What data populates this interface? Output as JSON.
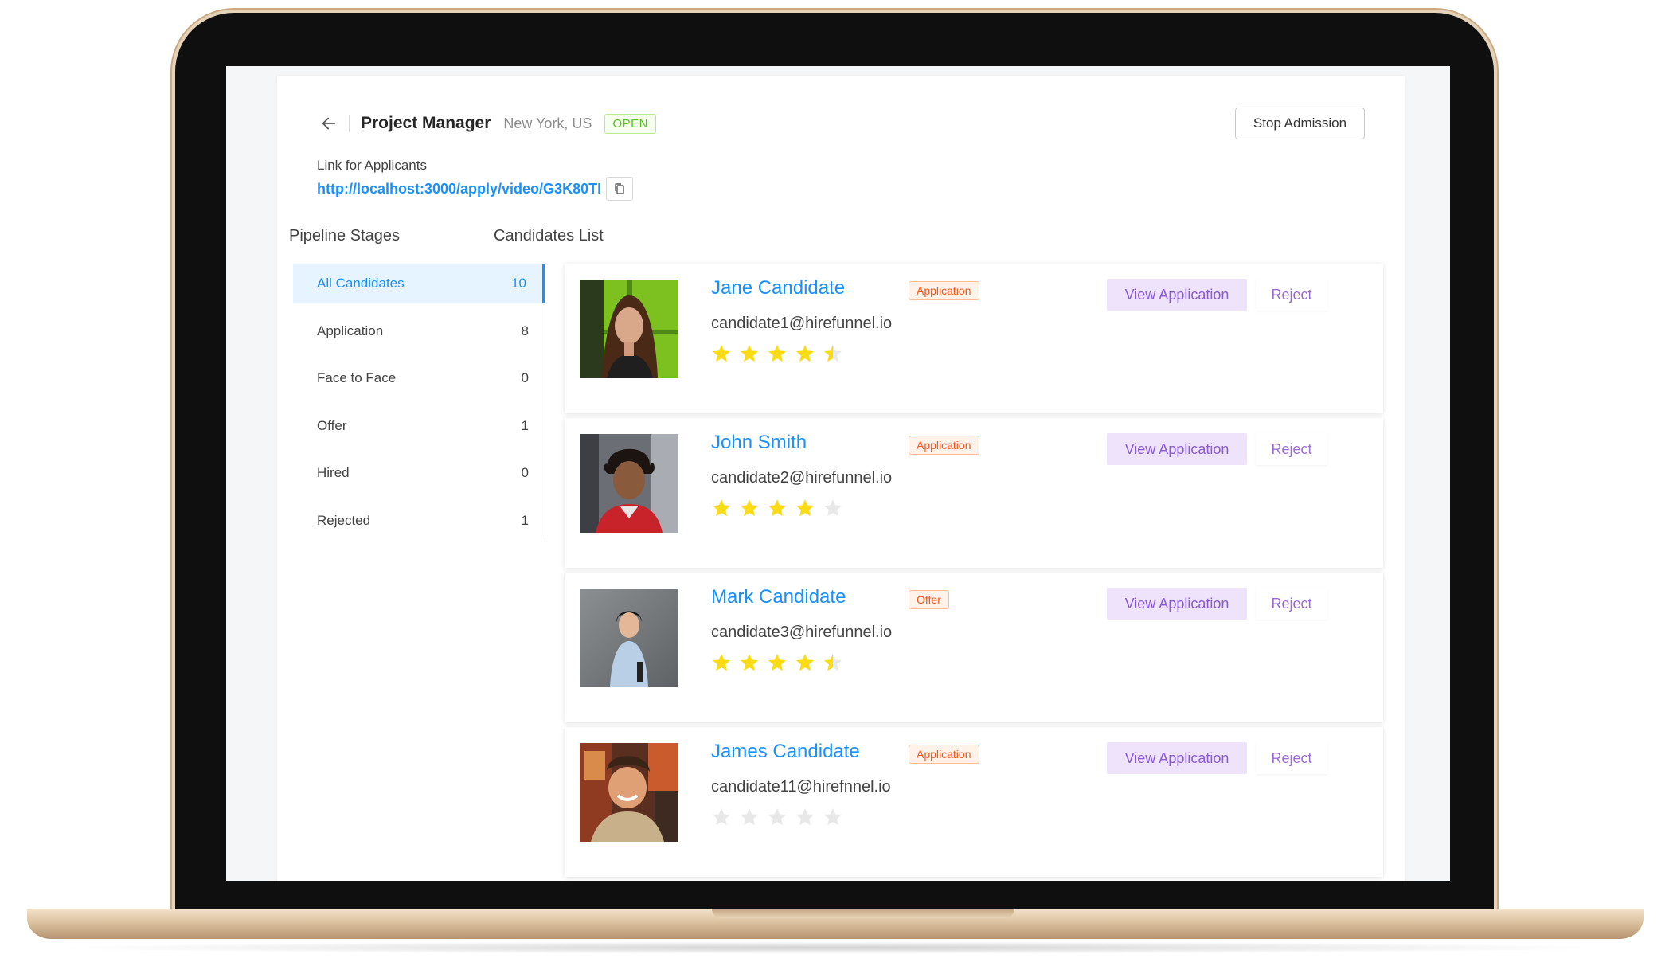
{
  "header": {
    "title": "Project Manager",
    "location": "New York, US",
    "status": "OPEN",
    "stop_label": "Stop Admission"
  },
  "link": {
    "label": "Link for Applicants",
    "url": "http://localhost:3000/apply/video/G3K80TI"
  },
  "pipeline": {
    "title": "Pipeline Stages",
    "stages": [
      {
        "label": "All Candidates",
        "count": "10"
      },
      {
        "label": "Application",
        "count": "8"
      },
      {
        "label": "Face to Face",
        "count": "0"
      },
      {
        "label": "Offer",
        "count": "1"
      },
      {
        "label": "Hired",
        "count": "0"
      },
      {
        "label": "Rejected",
        "count": "1"
      }
    ]
  },
  "candidates": {
    "title": "Candidates List",
    "view_label": "View Application",
    "reject_label": "Reject",
    "items": [
      {
        "name": "Jane Candidate",
        "stage": "Application",
        "email": "candidate1@hirefunnel.io",
        "rating": 4.5
      },
      {
        "name": "John Smith",
        "stage": "Application",
        "email": "candidate2@hirefunnel.io",
        "rating": 4
      },
      {
        "name": "Mark Candidate",
        "stage": "Offer",
        "email": "candidate3@hirefunnel.io",
        "rating": 4.5
      },
      {
        "name": "James Candidate",
        "stage": "Application",
        "email": "candidate11@hirefnnel.io",
        "rating": 0
      }
    ]
  },
  "colors": {
    "accent": "#1890ff",
    "star_filled": "#fadb14",
    "star_empty": "#e8e8e8",
    "open_badge": "#52c41a",
    "stage_tag": "#fa541c",
    "view_button": "#8a5ad8"
  }
}
